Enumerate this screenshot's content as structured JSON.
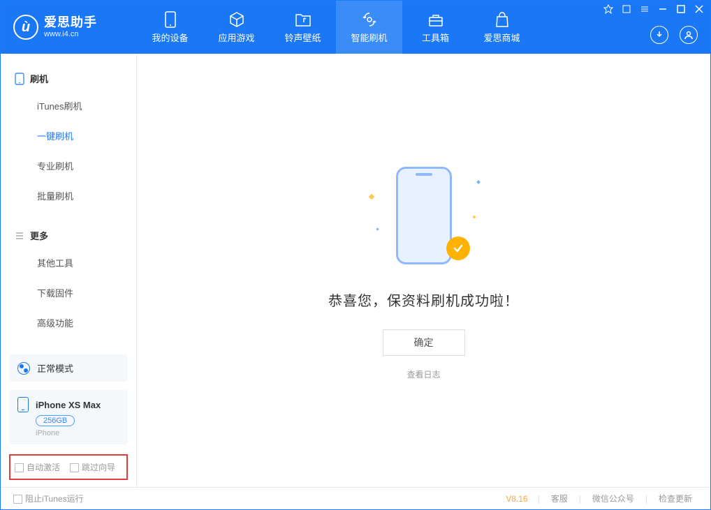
{
  "app": {
    "title": "爱思助手",
    "url": "www.i4.cn"
  },
  "nav": {
    "items": [
      {
        "label": "我的设备"
      },
      {
        "label": "应用游戏"
      },
      {
        "label": "铃声壁纸"
      },
      {
        "label": "智能刷机"
      },
      {
        "label": "工具箱"
      },
      {
        "label": "爱思商城"
      }
    ]
  },
  "sidebar": {
    "section1": {
      "title": "刷机",
      "items": [
        {
          "label": "iTunes刷机"
        },
        {
          "label": "一键刷机"
        },
        {
          "label": "专业刷机"
        },
        {
          "label": "批量刷机"
        }
      ]
    },
    "section2": {
      "title": "更多",
      "items": [
        {
          "label": "其他工具"
        },
        {
          "label": "下载固件"
        },
        {
          "label": "高级功能"
        }
      ]
    },
    "mode": {
      "label": "正常模式"
    },
    "device": {
      "name": "iPhone XS Max",
      "storage": "256GB",
      "type": "iPhone"
    },
    "checkboxes": {
      "auto_activate": "自动激活",
      "skip_guide": "跳过向导"
    }
  },
  "main": {
    "success_text": "恭喜您，保资料刷机成功啦！",
    "ok_button": "确定",
    "view_log": "查看日志"
  },
  "footer": {
    "block_itunes": "阻止iTunes运行",
    "version": "V8.16",
    "links": {
      "service": "客服",
      "wechat": "微信公众号",
      "update": "检查更新"
    }
  }
}
